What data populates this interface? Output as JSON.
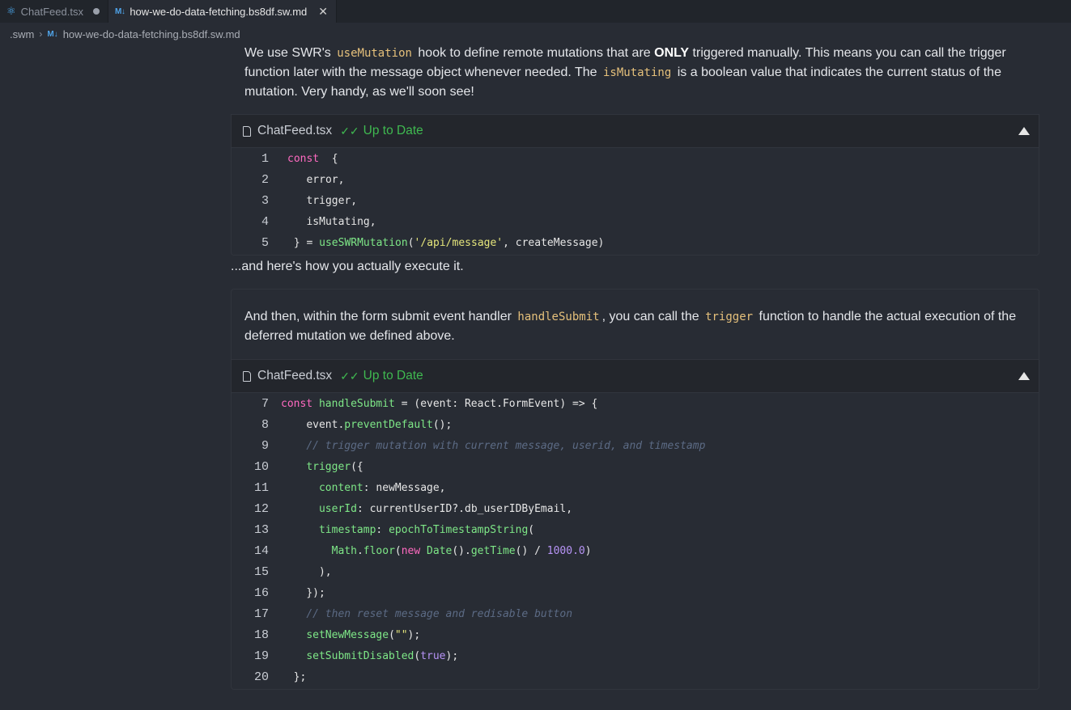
{
  "tabs": [
    {
      "label": "ChatFeed.tsx",
      "icon": "react-icon",
      "modified": true
    },
    {
      "label": "how-we-do-data-fetching.bs8df.sw.md",
      "icon": "markdown-icon",
      "active": true
    }
  ],
  "breadcrumb": {
    "folder": ".swm",
    "file": "how-we-do-data-fetching.bs8df.sw.md"
  },
  "para1": {
    "t1": "We use SWR's ",
    "c1": "useMutation",
    "t2": " hook to define remote mutations that are ",
    "bold": "ONLY",
    "t3": " triggered manually. This means you can call the trigger function later with the message object whenever needed. The ",
    "c2": "isMutating",
    "t4": " is a boolean value that indicates the current status of the mutation. Very handy, as we'll soon see!"
  },
  "snippet1": {
    "file": "ChatFeed.tsx",
    "status": "Up to Date",
    "lines": [
      {
        "n": "1",
        "indent": "",
        "parts": [
          [
            "kw",
            "const"
          ],
          [
            "",
            "  {"
          ]
        ]
      },
      {
        "n": "2",
        "indent": "   ",
        "parts": [
          [
            "",
            "error,"
          ]
        ]
      },
      {
        "n": "3",
        "indent": "   ",
        "parts": [
          [
            "",
            "trigger,"
          ]
        ]
      },
      {
        "n": "4",
        "indent": "   ",
        "parts": [
          [
            "",
            "isMutating,"
          ]
        ]
      },
      {
        "n": "5",
        "indent": " ",
        "parts": [
          [
            "",
            "} = "
          ],
          [
            "fn",
            "useSWRMutation"
          ],
          [
            "",
            "("
          ],
          [
            "str",
            "'/api/message'"
          ],
          [
            "",
            ", createMessage)"
          ]
        ]
      }
    ]
  },
  "mid_text": "...and here's how you actually execute it.",
  "para2": {
    "t1": "And then, within the form submit event handler ",
    "c1": "handleSubmit",
    "t2": ", you can call the ",
    "c2": "trigger",
    "t3": " function to handle the actual execution of the deferred mutation we defined above."
  },
  "snippet2": {
    "file": "ChatFeed.tsx",
    "status": "Up to Date",
    "lines": [
      {
        "n": "7",
        "indent": "",
        "parts": [
          [
            "kw",
            "const"
          ],
          [
            "",
            " "
          ],
          [
            "fn",
            "handleSubmit"
          ],
          [
            "",
            " = (event: React.FormEvent) => {"
          ]
        ]
      },
      {
        "n": "8",
        "indent": "    ",
        "parts": [
          [
            "",
            "event."
          ],
          [
            "fn",
            "preventDefault"
          ],
          [
            "",
            "();"
          ]
        ]
      },
      {
        "n": "9",
        "indent": "    ",
        "parts": [
          [
            "cm",
            "// trigger mutation with current message, userid, and timestamp"
          ]
        ]
      },
      {
        "n": "10",
        "indent": "    ",
        "parts": [
          [
            "fn",
            "trigger"
          ],
          [
            "",
            "({"
          ]
        ]
      },
      {
        "n": "11",
        "indent": "      ",
        "parts": [
          [
            "fn",
            "content"
          ],
          [
            "",
            ": newMessage,"
          ]
        ]
      },
      {
        "n": "12",
        "indent": "      ",
        "parts": [
          [
            "fn",
            "userId"
          ],
          [
            "",
            ": currentUserID?.db_userIDByEmail,"
          ]
        ]
      },
      {
        "n": "13",
        "indent": "      ",
        "parts": [
          [
            "fn",
            "timestamp"
          ],
          [
            "",
            ": "
          ],
          [
            "fn",
            "epochToTimestampString"
          ],
          [
            "",
            "("
          ]
        ]
      },
      {
        "n": "14",
        "indent": "        ",
        "parts": [
          [
            "fn",
            "Math"
          ],
          [
            "",
            "."
          ],
          [
            "fn",
            "floor"
          ],
          [
            "",
            "("
          ],
          [
            "kw",
            "new"
          ],
          [
            "",
            " "
          ],
          [
            "fn",
            "Date"
          ],
          [
            "",
            "()."
          ],
          [
            "fn",
            "getTime"
          ],
          [
            "",
            "() / "
          ],
          [
            "num",
            "1000.0"
          ],
          [
            "",
            ")"
          ]
        ]
      },
      {
        "n": "15",
        "indent": "      ",
        "parts": [
          [
            "",
            "),"
          ]
        ]
      },
      {
        "n": "16",
        "indent": "    ",
        "parts": [
          [
            "",
            "});"
          ]
        ]
      },
      {
        "n": "17",
        "indent": "    ",
        "parts": [
          [
            "cm",
            "// then reset message and redisable button"
          ]
        ]
      },
      {
        "n": "18",
        "indent": "    ",
        "parts": [
          [
            "fn",
            "setNewMessage"
          ],
          [
            "",
            "("
          ],
          [
            "str",
            "\"\""
          ],
          [
            "",
            ");"
          ]
        ]
      },
      {
        "n": "19",
        "indent": "    ",
        "parts": [
          [
            "fn",
            "setSubmitDisabled"
          ],
          [
            "",
            "("
          ],
          [
            "num",
            "true"
          ],
          [
            "",
            ");"
          ]
        ]
      },
      {
        "n": "20",
        "indent": "  ",
        "parts": [
          [
            "",
            "};"
          ]
        ]
      }
    ]
  }
}
